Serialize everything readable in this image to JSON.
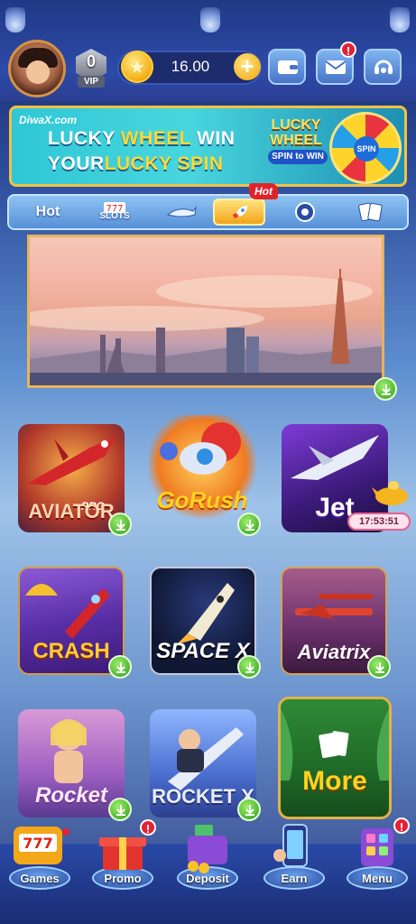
{
  "header": {
    "vip_level": "0",
    "vip_label": "VIP",
    "balance": "16.00",
    "add_symbol": "+",
    "mail_badge": "!"
  },
  "banner": {
    "brand": "DiwaX.com",
    "line1_a": "LUCKY ",
    "line1_b": "WHEEL",
    "line1_c": " WIN",
    "line2_a": "YOUR",
    "line2_b": "LUCKY SPIN",
    "wheel_title": "LUCKY WHEEL",
    "wheel_button": "SPIN to WIN",
    "wheel_center": "SPIN"
  },
  "tabs": {
    "items": [
      {
        "label": "Hot"
      },
      {
        "label": "SLOTS"
      },
      {
        "label": "fishing"
      },
      {
        "label": "crash"
      },
      {
        "label": "roulette"
      },
      {
        "label": "cards"
      }
    ],
    "hot_flag": "Hot"
  },
  "games": [
    {
      "name": "AVIATOR",
      "tag": "PRO"
    },
    {
      "name": "GoRush"
    },
    {
      "name": "Jet"
    },
    {
      "name": "CRASH"
    },
    {
      "name": "SPACE X"
    },
    {
      "name": "Aviatrix"
    },
    {
      "name": "Rocket"
    },
    {
      "name": "ROCKET X"
    },
    {
      "name": "More"
    }
  ],
  "jet_timer": "17:53:51",
  "nav": {
    "items": [
      {
        "label": "Games"
      },
      {
        "label": "Promo",
        "badge": "!"
      },
      {
        "label": "Deposit"
      },
      {
        "label": "Earn"
      },
      {
        "label": "Menu",
        "badge": "!"
      }
    ]
  },
  "colors": {
    "accent_gold": "#f2a41a",
    "download_green": "#2f9b1d",
    "badge_red": "#e32235"
  }
}
